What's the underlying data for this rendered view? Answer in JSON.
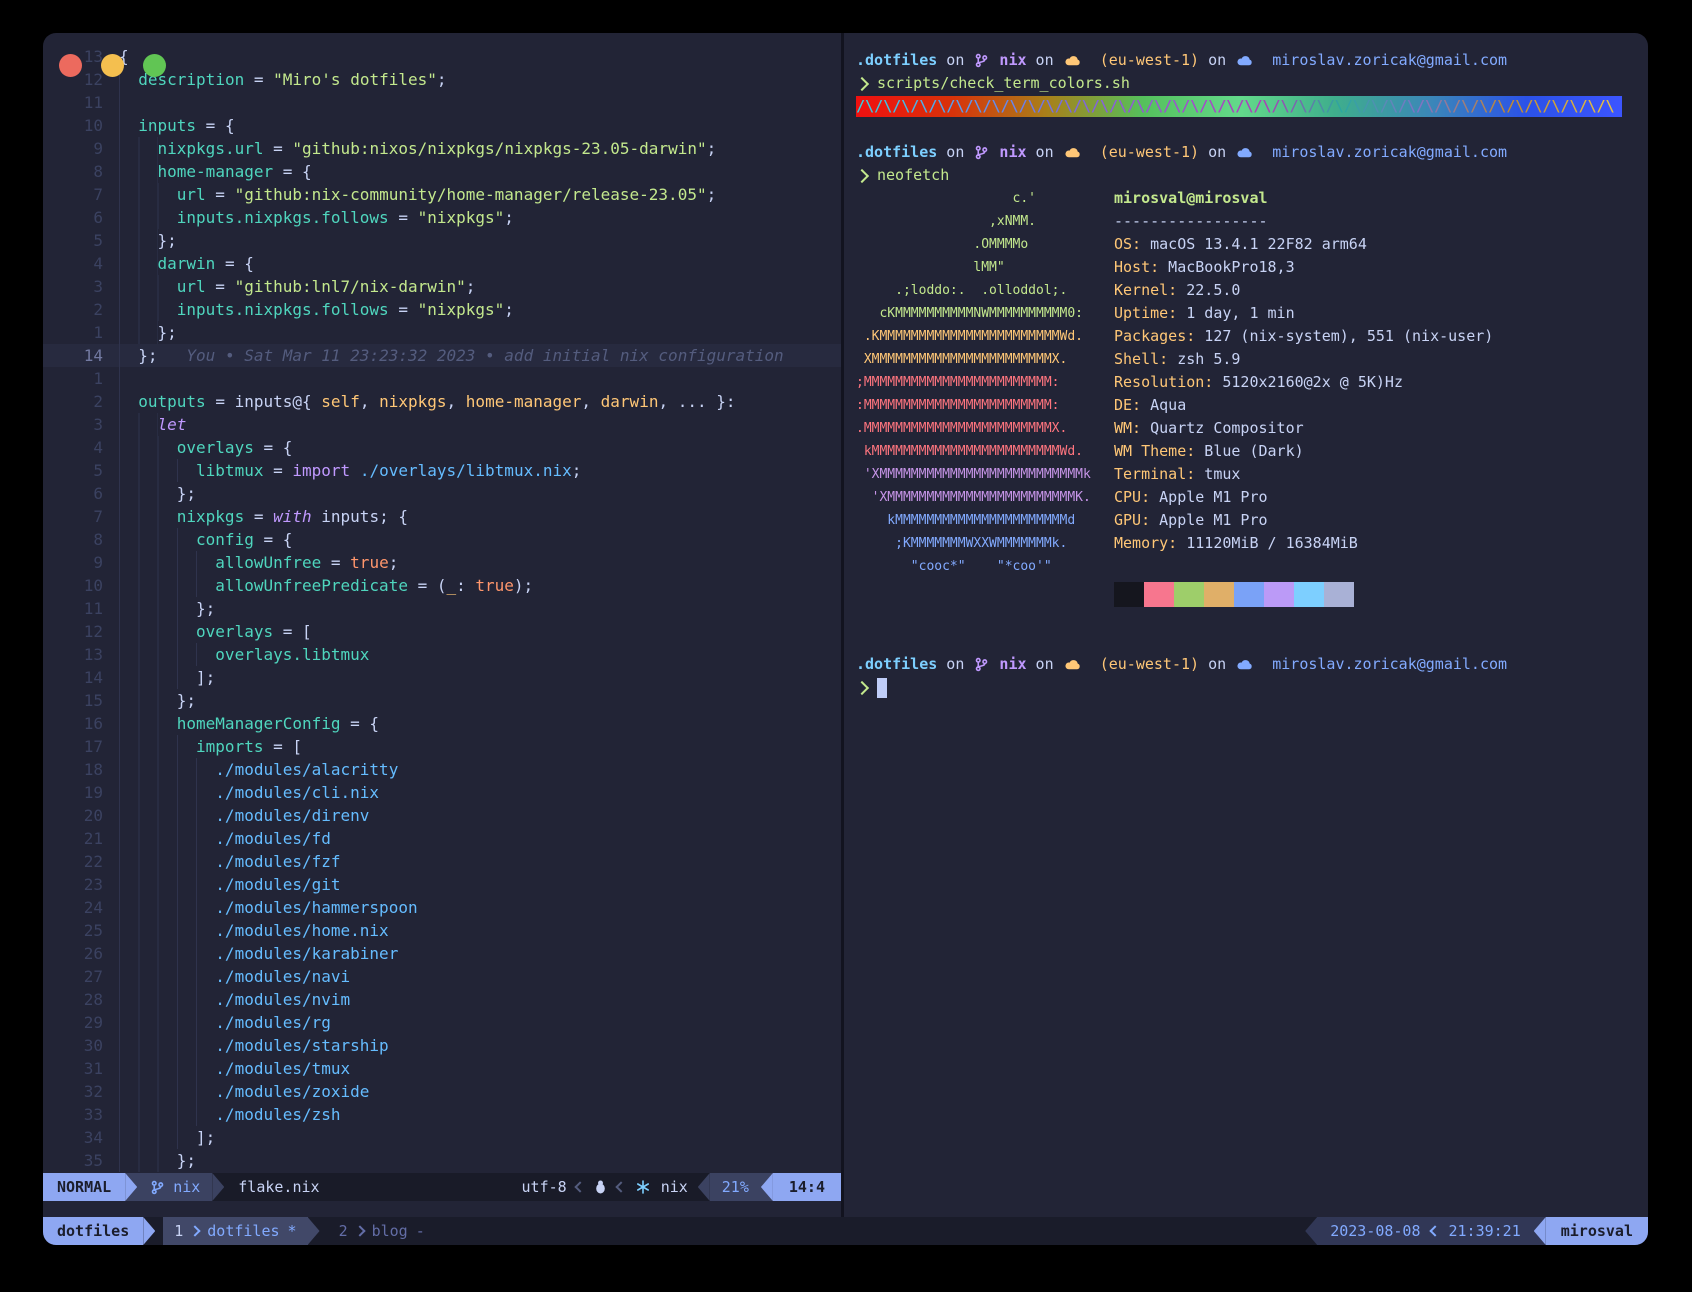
{
  "colors": {
    "fg": "#c8d3f5",
    "teal": "#4fd6be",
    "green": "#c3e88d",
    "purple": "#c099ff",
    "orange": "#ff966c",
    "yellow": "#ffc777",
    "blue": "#82aaff",
    "cyan": "#65bcff",
    "dim": "#636da6",
    "red": "#ff757f",
    "magenta": "#c795e8",
    "sky": "#7dcfff",
    "accent_segment": "#8ea7f2",
    "segment_dark": "#3b4261"
  },
  "editor": {
    "blame": "You • Sat Mar 11 23:23:32 2023 • add initial nix configuration",
    "lines": [
      {
        "n": "13",
        "i": 0,
        "s": [
          [
            "{",
            "fg"
          ]
        ]
      },
      {
        "n": "12",
        "i": 2,
        "s": [
          [
            "description",
            "teal"
          ],
          [
            " = ",
            "fg"
          ],
          [
            "\"Miro's dotfiles\"",
            "green"
          ],
          [
            ";",
            "fg"
          ]
        ]
      },
      {
        "n": "11",
        "i": 2,
        "s": []
      },
      {
        "n": "10",
        "i": 2,
        "s": [
          [
            "inputs",
            "teal"
          ],
          [
            " = {",
            "fg"
          ]
        ]
      },
      {
        "n": "9",
        "i": 4,
        "s": [
          [
            "nixpkgs.url",
            "teal"
          ],
          [
            " = ",
            "fg"
          ],
          [
            "\"github:nixos/nixpkgs/nixpkgs-23.05-darwin\"",
            "green"
          ],
          [
            ";",
            "fg"
          ]
        ]
      },
      {
        "n": "8",
        "i": 4,
        "s": [
          [
            "home-manager",
            "teal"
          ],
          [
            " = {",
            "fg"
          ]
        ]
      },
      {
        "n": "7",
        "i": 6,
        "s": [
          [
            "url",
            "teal"
          ],
          [
            " = ",
            "fg"
          ],
          [
            "\"github:nix-community/home-manager/release-23.05\"",
            "green"
          ],
          [
            ";",
            "fg"
          ]
        ]
      },
      {
        "n": "6",
        "i": 6,
        "s": [
          [
            "inputs.nixpkgs.follows",
            "teal"
          ],
          [
            " = ",
            "fg"
          ],
          [
            "\"nixpkgs\"",
            "green"
          ],
          [
            ";",
            "fg"
          ]
        ]
      },
      {
        "n": "5",
        "i": 4,
        "s": [
          [
            "};",
            "fg"
          ]
        ]
      },
      {
        "n": "4",
        "i": 4,
        "s": [
          [
            "darwin",
            "teal"
          ],
          [
            " = {",
            "fg"
          ]
        ]
      },
      {
        "n": "3",
        "i": 6,
        "s": [
          [
            "url",
            "teal"
          ],
          [
            " = ",
            "fg"
          ],
          [
            "\"github:lnl7/nix-darwin\"",
            "green"
          ],
          [
            ";",
            "fg"
          ]
        ]
      },
      {
        "n": "2",
        "i": 6,
        "s": [
          [
            "inputs.nixpkgs.follows",
            "teal"
          ],
          [
            " = ",
            "fg"
          ],
          [
            "\"nixpkgs\"",
            "green"
          ],
          [
            ";",
            "fg"
          ]
        ]
      },
      {
        "n": "1",
        "i": 4,
        "s": [
          [
            "};",
            "fg"
          ]
        ]
      },
      {
        "n": "14",
        "i": 2,
        "cur": true,
        "blame": true,
        "s": [
          [
            "};",
            "fg"
          ]
        ]
      },
      {
        "n": "1",
        "i": 2,
        "s": []
      },
      {
        "n": "2",
        "i": 2,
        "s": [
          [
            "outputs",
            "teal"
          ],
          [
            " = ",
            "fg"
          ],
          [
            "inputs",
            "fg"
          ],
          [
            "@{ ",
            "fg"
          ],
          [
            "self",
            "yellow"
          ],
          [
            ", ",
            "fg"
          ],
          [
            "nixpkgs",
            "yellow"
          ],
          [
            ", ",
            "fg"
          ],
          [
            "home-manager",
            "yellow"
          ],
          [
            ", ",
            "fg"
          ],
          [
            "darwin",
            "yellow"
          ],
          [
            ", ... }:",
            "fg"
          ]
        ]
      },
      {
        "n": "3",
        "i": 4,
        "s": [
          [
            "let",
            "purpleI"
          ]
        ]
      },
      {
        "n": "4",
        "i": 6,
        "s": [
          [
            "overlays",
            "teal"
          ],
          [
            " = {",
            "fg"
          ]
        ]
      },
      {
        "n": "5",
        "i": 8,
        "s": [
          [
            "libtmux",
            "teal"
          ],
          [
            " = ",
            "fg"
          ],
          [
            "import",
            "purple"
          ],
          [
            " ",
            "fg"
          ],
          [
            "./overlays/libtmux.nix",
            "cyan"
          ],
          [
            ";",
            "fg"
          ]
        ]
      },
      {
        "n": "6",
        "i": 6,
        "s": [
          [
            "};",
            "fg"
          ]
        ]
      },
      {
        "n": "7",
        "i": 6,
        "s": [
          [
            "nixpkgs",
            "teal"
          ],
          [
            " = ",
            "fg"
          ],
          [
            "with",
            "purpleI"
          ],
          [
            " inputs",
            "fg"
          ],
          [
            "; {",
            "fg"
          ]
        ]
      },
      {
        "n": "8",
        "i": 8,
        "s": [
          [
            "config",
            "teal"
          ],
          [
            " = {",
            "fg"
          ]
        ]
      },
      {
        "n": "9",
        "i": 10,
        "s": [
          [
            "allowUnfree",
            "teal"
          ],
          [
            " = ",
            "fg"
          ],
          [
            "true",
            "orange"
          ],
          [
            ";",
            "fg"
          ]
        ]
      },
      {
        "n": "10",
        "i": 10,
        "s": [
          [
            "allowUnfreePredicate",
            "teal"
          ],
          [
            " = (",
            "fg"
          ],
          [
            "_",
            "yellow"
          ],
          [
            ": ",
            "fg"
          ],
          [
            "true",
            "orange"
          ],
          [
            ");",
            "fg"
          ]
        ]
      },
      {
        "n": "11",
        "i": 8,
        "s": [
          [
            "};",
            "fg"
          ]
        ]
      },
      {
        "n": "12",
        "i": 8,
        "s": [
          [
            "overlays",
            "teal"
          ],
          [
            " = [",
            "fg"
          ]
        ]
      },
      {
        "n": "13",
        "i": 10,
        "s": [
          [
            "overlays.libtmux",
            "teal"
          ]
        ]
      },
      {
        "n": "14",
        "i": 8,
        "s": [
          [
            "];",
            "fg"
          ]
        ]
      },
      {
        "n": "15",
        "i": 6,
        "s": [
          [
            "};",
            "fg"
          ]
        ]
      },
      {
        "n": "16",
        "i": 6,
        "s": [
          [
            "homeManagerConfig",
            "teal"
          ],
          [
            " = {",
            "fg"
          ]
        ]
      },
      {
        "n": "17",
        "i": 8,
        "s": [
          [
            "imports",
            "teal"
          ],
          [
            " = [",
            "fg"
          ]
        ]
      },
      {
        "n": "18",
        "i": 10,
        "s": [
          [
            "./modules/alacritty",
            "cyan"
          ]
        ]
      },
      {
        "n": "19",
        "i": 10,
        "s": [
          [
            "./modules/cli.nix",
            "cyan"
          ]
        ]
      },
      {
        "n": "20",
        "i": 10,
        "s": [
          [
            "./modules/direnv",
            "cyan"
          ]
        ]
      },
      {
        "n": "21",
        "i": 10,
        "s": [
          [
            "./modules/fd",
            "cyan"
          ]
        ]
      },
      {
        "n": "22",
        "i": 10,
        "s": [
          [
            "./modules/fzf",
            "cyan"
          ]
        ]
      },
      {
        "n": "23",
        "i": 10,
        "s": [
          [
            "./modules/git",
            "cyan"
          ]
        ]
      },
      {
        "n": "24",
        "i": 10,
        "s": [
          [
            "./modules/hammerspoon",
            "cyan"
          ]
        ]
      },
      {
        "n": "25",
        "i": 10,
        "s": [
          [
            "./modules/home.nix",
            "cyan"
          ]
        ]
      },
      {
        "n": "26",
        "i": 10,
        "s": [
          [
            "./modules/karabiner",
            "cyan"
          ]
        ]
      },
      {
        "n": "27",
        "i": 10,
        "s": [
          [
            "./modules/navi",
            "cyan"
          ]
        ]
      },
      {
        "n": "28",
        "i": 10,
        "s": [
          [
            "./modules/nvim",
            "cyan"
          ]
        ]
      },
      {
        "n": "29",
        "i": 10,
        "s": [
          [
            "./modules/rg",
            "cyan"
          ]
        ]
      },
      {
        "n": "30",
        "i": 10,
        "s": [
          [
            "./modules/starship",
            "cyan"
          ]
        ]
      },
      {
        "n": "31",
        "i": 10,
        "s": [
          [
            "./modules/tmux",
            "cyan"
          ]
        ]
      },
      {
        "n": "32",
        "i": 10,
        "s": [
          [
            "./modules/zoxide",
            "cyan"
          ]
        ]
      },
      {
        "n": "33",
        "i": 10,
        "s": [
          [
            "./modules/zsh",
            "cyan"
          ]
        ]
      },
      {
        "n": "34",
        "i": 8,
        "s": [
          [
            "];",
            "fg"
          ]
        ]
      },
      {
        "n": "35",
        "i": 6,
        "s": [
          [
            "};",
            "fg"
          ]
        ]
      }
    ],
    "statusline": {
      "mode": "NORMAL",
      "branch": "nix",
      "filename": "flake.nix",
      "encoding": "utf-8",
      "lang": "nix",
      "percent": "21%",
      "position": "14:4"
    }
  },
  "terminal": {
    "prompt": {
      "dir": ".dotfiles",
      "on": "on",
      "branch": "nix",
      "region": "(eu-west-1)",
      "email": "miroslav.zoricak@gmail.com"
    },
    "commands": [
      "scripts/check_term_colors.sh",
      "neofetch"
    ],
    "stripe": {
      "unit": "/\\",
      "repeat": 42,
      "gradient": [
        "#ef1010",
        "#d8320a",
        "#a8801a",
        "#55c05c",
        "#63d98a",
        "#3fae8c",
        "#3b87b8",
        "#2b52e8",
        "#3c55ff"
      ]
    },
    "neofetch": {
      "art": [
        [
          "                    c.'",
          "g"
        ],
        [
          "                 ,xNMM.",
          "g"
        ],
        [
          "               .OMMMMo",
          "g"
        ],
        [
          "               lMM\"",
          "g"
        ],
        [
          "     .;loddo:.  .olloddol;.",
          "g"
        ],
        [
          "   cKMMMMMMMMMMNWMMMMMMMMMM0:",
          "g"
        ],
        [
          " .KMMMMMMMMMMMMMMMMMMMMMMMWd.",
          "y"
        ],
        [
          " XMMMMMMMMMMMMMMMMMMMMMMMX.",
          "y"
        ],
        [
          ";MMMMMMMMMMMMMMMMMMMMMMMM:",
          "r"
        ],
        [
          ":MMMMMMMMMMMMMMMMMMMMMMMM:",
          "r"
        ],
        [
          ".MMMMMMMMMMMMMMMMMMMMMMMMX.",
          "r"
        ],
        [
          " kMMMMMMMMMMMMMMMMMMMMMMMMWd.",
          "r"
        ],
        [
          " 'XMMMMMMMMMMMMMMMMMMMMMMMMMMk",
          "m"
        ],
        [
          "  'XMMMMMMMMMMMMMMMMMMMMMMMMK.",
          "m"
        ],
        [
          "    kMMMMMMMMMMMMMMMMMMMMMMd",
          "b"
        ],
        [
          "     ;KMMMMMMMWXXWMMMMMMMk.",
          "b"
        ],
        [
          "       \"cooc*\"    \"*coo'\"",
          "b"
        ]
      ],
      "title": "mirosval@mirosval",
      "separator": "-----------------",
      "info": [
        [
          "OS",
          "macOS 13.4.1 22F82 arm64"
        ],
        [
          "Host",
          "MacBookPro18,3"
        ],
        [
          "Kernel",
          "22.5.0"
        ],
        [
          "Uptime",
          "1 day, 1 min"
        ],
        [
          "Packages",
          "127 (nix-system), 551 (nix-user)"
        ],
        [
          "Shell",
          "zsh 5.9"
        ],
        [
          "Resolution",
          "5120x2160@2x @ 5K)Hz"
        ],
        [
          "DE",
          "Aqua"
        ],
        [
          "WM",
          "Quartz Compositor"
        ],
        [
          "WM Theme",
          "Blue (Dark)"
        ],
        [
          "Terminal",
          "tmux"
        ],
        [
          "CPU",
          "Apple M1 Pro"
        ],
        [
          "GPU",
          "Apple M1 Pro"
        ],
        [
          "Memory",
          "11120MiB / 16384MiB"
        ]
      ],
      "palette": [
        "#15161e",
        "#f7768e",
        "#9ece6a",
        "#e0af68",
        "#7aa2f7",
        "#bb9af7",
        "#7dcfff",
        "#a9b1d6"
      ]
    }
  },
  "tmux": {
    "session": "dotfiles",
    "windows": [
      {
        "index": "1",
        "name": "dotfiles",
        "flag": "*"
      },
      {
        "index": "2",
        "name": "blog",
        "flag": "-"
      }
    ],
    "date": "2023-08-08",
    "time": "21:39:21",
    "host": "mirosval"
  }
}
